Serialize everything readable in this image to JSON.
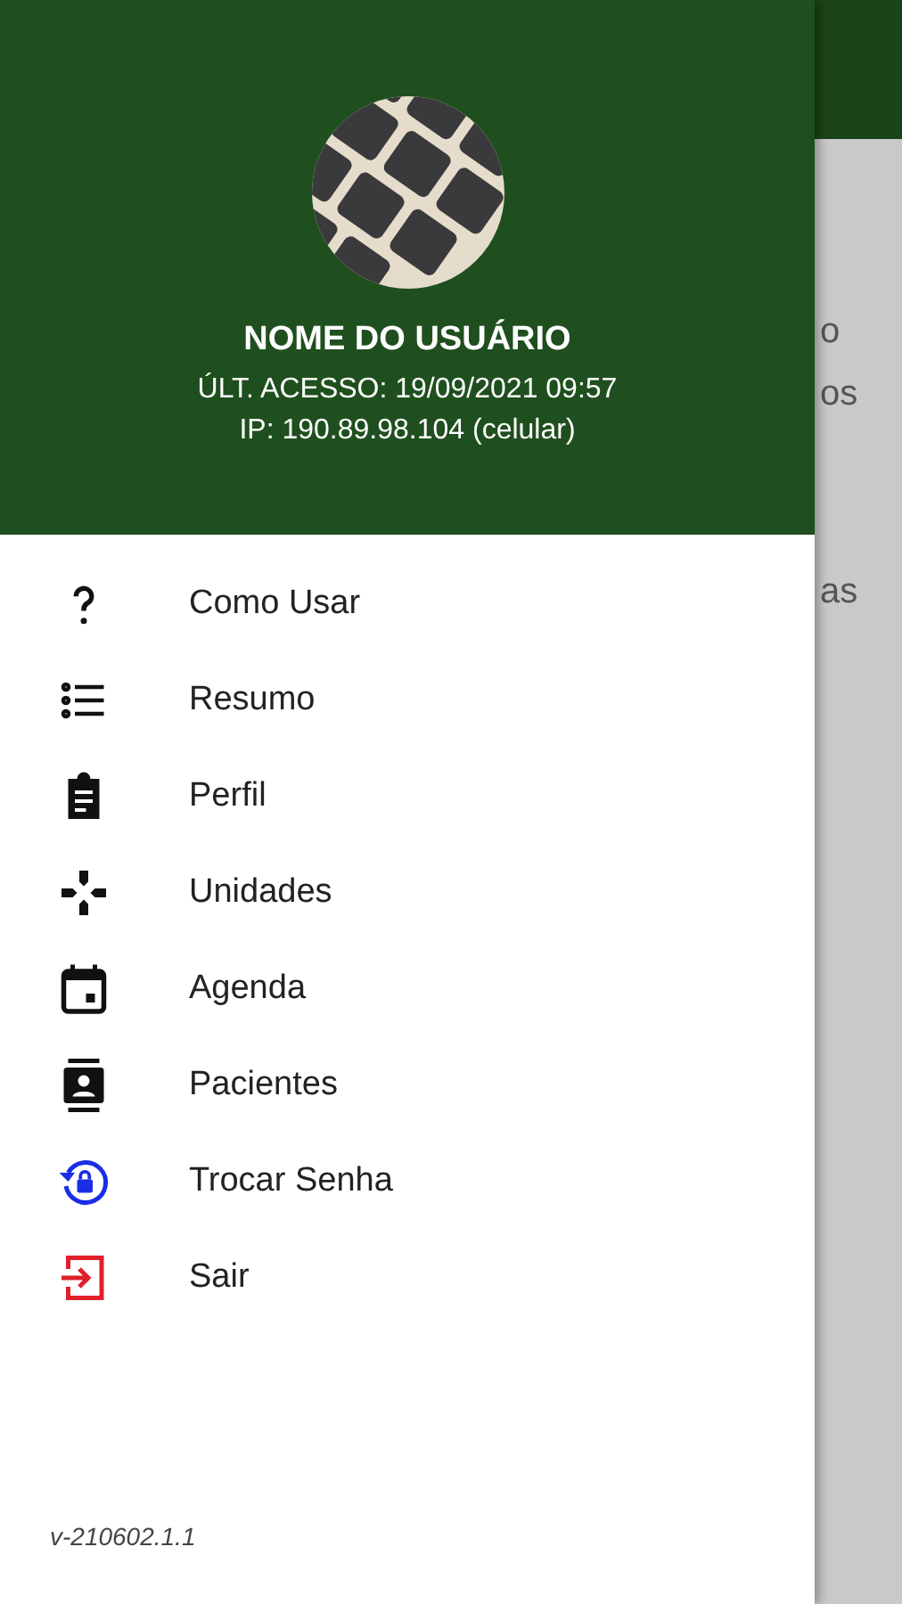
{
  "drawer": {
    "user_name": "NOME DO USUÁRIO",
    "last_access": "ÚLT. ACESSO: 19/09/2021 09:57",
    "ip": "IP: 190.89.98.104 (celular)",
    "menu": [
      {
        "kind": "help",
        "label": "Como Usar",
        "color": "#111111"
      },
      {
        "kind": "list",
        "label": "Resumo",
        "color": "#111111"
      },
      {
        "kind": "clipboard",
        "label": "Perfil",
        "color": "#111111"
      },
      {
        "kind": "units",
        "label": "Unidades",
        "color": "#111111"
      },
      {
        "kind": "calendar",
        "label": "Agenda",
        "color": "#111111"
      },
      {
        "kind": "contacts",
        "label": "Pacientes",
        "color": "#111111"
      },
      {
        "kind": "lock",
        "label": "Trocar Senha",
        "color": "#1a2ee6"
      },
      {
        "kind": "exit",
        "label": "Sair",
        "color": "#e0202a"
      }
    ],
    "version": "v-210602.1.1"
  },
  "background": {
    "fragments": [
      "o",
      "os",
      "as"
    ]
  }
}
